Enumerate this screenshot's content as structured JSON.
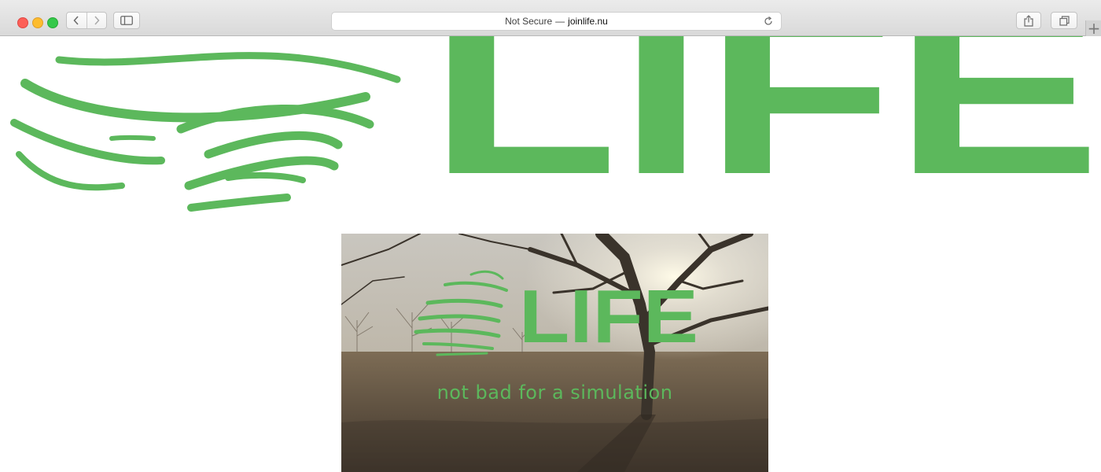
{
  "browser": {
    "address_prefix": "Not Secure",
    "address_separator": "—",
    "address_domain": "joinlife.nu",
    "buttons": {
      "back": "chevron-left-icon",
      "forward": "chevron-right-icon",
      "sidebar": "sidebar-icon",
      "reload": "reload-icon",
      "share": "share-icon",
      "tabs": "tabs-overview-icon",
      "new_tab": "+"
    }
  },
  "page": {
    "logo_text": "LIFE",
    "video": {
      "logo_text": "LIFE",
      "tagline": "not bad for a simulation"
    }
  },
  "colors": {
    "brand_green": "#5cb85c",
    "traffic_red": "#fc5f57",
    "traffic_yellow": "#fdbc2e",
    "traffic_green": "#34c84a"
  }
}
